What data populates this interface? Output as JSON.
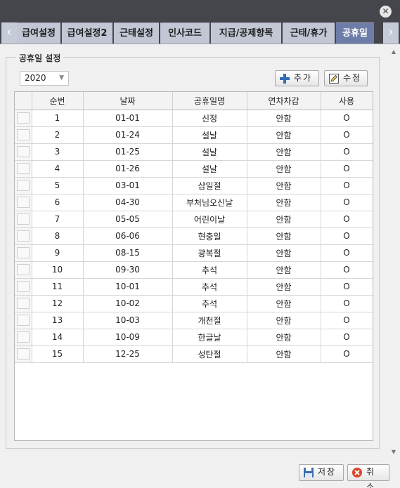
{
  "tabs": [
    {
      "label": "급여설정",
      "active": false
    },
    {
      "label": "급여설정2",
      "active": false
    },
    {
      "label": "근태설정",
      "active": false
    },
    {
      "label": "인사코드",
      "active": false
    },
    {
      "label": "지급/공제항목",
      "active": false
    },
    {
      "label": "근태/휴가",
      "active": false
    },
    {
      "label": "공휴일",
      "active": true
    }
  ],
  "group_title": "공휴일 설정",
  "year_select": {
    "value": "2020"
  },
  "buttons": {
    "add": "추가",
    "edit": "수정",
    "save": "저장",
    "cancel": "취소"
  },
  "table": {
    "columns": [
      "",
      "순번",
      "날짜",
      "공휴일명",
      "연차차감",
      "사용"
    ],
    "rows": [
      {
        "no": "1",
        "date": "01-01",
        "name": "신정",
        "deduct": "안함",
        "use": "O"
      },
      {
        "no": "2",
        "date": "01-24",
        "name": "설날",
        "deduct": "안함",
        "use": "O"
      },
      {
        "no": "3",
        "date": "01-25",
        "name": "설날",
        "deduct": "안함",
        "use": "O"
      },
      {
        "no": "4",
        "date": "01-26",
        "name": "설날",
        "deduct": "안함",
        "use": "O"
      },
      {
        "no": "5",
        "date": "03-01",
        "name": "삼일절",
        "deduct": "안함",
        "use": "O"
      },
      {
        "no": "6",
        "date": "04-30",
        "name": "부처님오신날",
        "deduct": "안함",
        "use": "O"
      },
      {
        "no": "7",
        "date": "05-05",
        "name": "어린이날",
        "deduct": "안함",
        "use": "O"
      },
      {
        "no": "8",
        "date": "06-06",
        "name": "현충일",
        "deduct": "안함",
        "use": "O"
      },
      {
        "no": "9",
        "date": "08-15",
        "name": "광복절",
        "deduct": "안함",
        "use": "O"
      },
      {
        "no": "10",
        "date": "09-30",
        "name": "추석",
        "deduct": "안함",
        "use": "O"
      },
      {
        "no": "11",
        "date": "10-01",
        "name": "추석",
        "deduct": "안함",
        "use": "O"
      },
      {
        "no": "12",
        "date": "10-02",
        "name": "추석",
        "deduct": "안함",
        "use": "O"
      },
      {
        "no": "13",
        "date": "10-03",
        "name": "개천절",
        "deduct": "안함",
        "use": "O"
      },
      {
        "no": "14",
        "date": "10-09",
        "name": "한글날",
        "deduct": "안함",
        "use": "O"
      },
      {
        "no": "15",
        "date": "12-25",
        "name": "성탄절",
        "deduct": "안함",
        "use": "O"
      }
    ]
  },
  "colors": {
    "tab_active": "#6e7da8",
    "tab_inactive": "#c3c7d5",
    "frame": "#45464b",
    "add_icon": "#2f6db5",
    "cancel_icon": "#d9442b"
  },
  "icons": {
    "close": "close-icon",
    "add": "plus-icon",
    "edit": "pencil-icon",
    "save": "floppy-disk-icon",
    "cancel": "cancel-icon"
  }
}
